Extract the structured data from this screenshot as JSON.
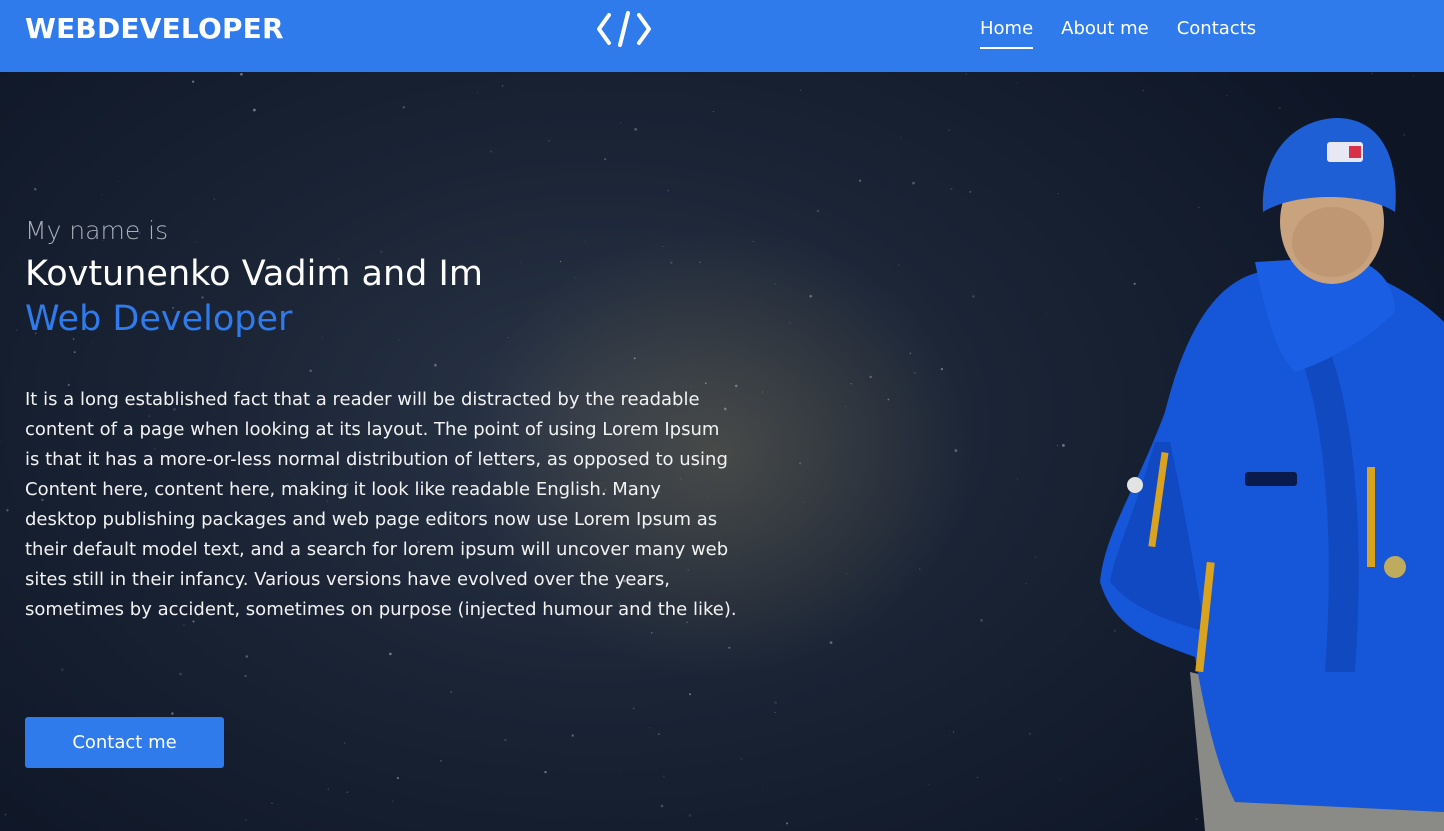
{
  "navbar": {
    "brand": "WEBDEVELOPER",
    "logo_icon": "code-brackets-icon",
    "links": [
      {
        "label": "Home",
        "active": true
      },
      {
        "label": "About me",
        "active": false
      },
      {
        "label": "Contacts",
        "active": false
      }
    ]
  },
  "hero": {
    "intro": "My name is",
    "name_line": "Kovtunenko Vadim and Im",
    "role": "Web Developer",
    "bio": "It is a long established fact that a reader will be distracted by the readable content of a page when looking at its layout. The point of using Lorem Ipsum is that it has a more-or-less normal distribution of letters, as opposed to using Content here, content here, making it look like readable English. Many desktop publishing packages and web page editors now use Lorem Ipsum as their default model text, and a search for lorem ipsum will uncover many web sites still in their infancy. Various versions have evolved over the years, sometimes by accident, sometimes on purpose (injected humour and the like).",
    "cta_label": "Contact me"
  },
  "colors": {
    "accent": "#2f7bec",
    "background": "#1a2435",
    "text": "#ffffff"
  }
}
